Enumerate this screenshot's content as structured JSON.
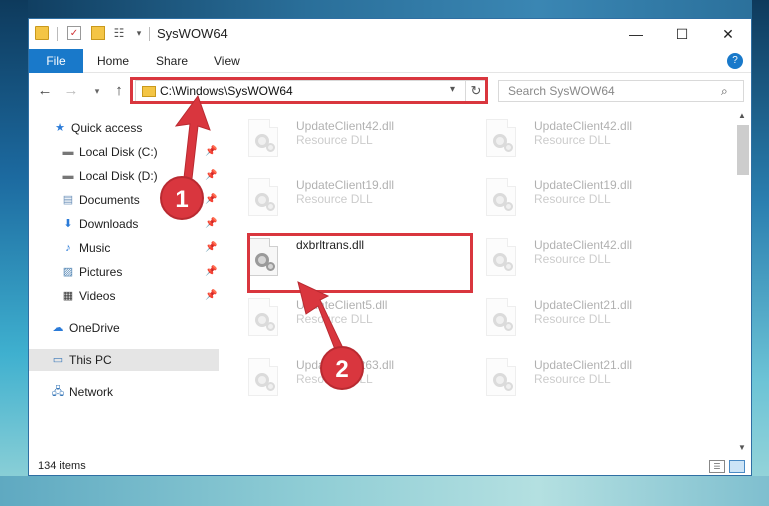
{
  "window": {
    "title": "SysWOW64",
    "minimize_icon": "minimize-icon",
    "maximize_icon": "maximize-icon",
    "close_icon": "close-icon"
  },
  "ribbon": {
    "tabs": [
      {
        "label": "File"
      },
      {
        "label": "Home"
      },
      {
        "label": "Share"
      },
      {
        "label": "View"
      }
    ]
  },
  "navigation": {
    "address": "C:\\Windows\\SysWOW64",
    "search_placeholder": "Search SysWOW64"
  },
  "sidebar": {
    "items": [
      {
        "label": "Quick access",
        "icon": "star-icon"
      },
      {
        "label": "Local Disk (C:)",
        "icon": "drive-icon",
        "pinned": true
      },
      {
        "label": "Local Disk (D:)",
        "icon": "drive-icon",
        "pinned": true
      },
      {
        "label": "Documents",
        "icon": "documents-icon",
        "pinned": true
      },
      {
        "label": "Downloads",
        "icon": "download-icon",
        "pinned": true
      },
      {
        "label": "Music",
        "icon": "music-icon",
        "pinned": true
      },
      {
        "label": "Pictures",
        "icon": "pictures-icon",
        "pinned": true
      },
      {
        "label": "Videos",
        "icon": "videos-icon",
        "pinned": true
      },
      {
        "label": "OneDrive",
        "icon": "cloud-icon"
      },
      {
        "label": "This PC",
        "icon": "computer-icon",
        "selected": true
      },
      {
        "label": "Network",
        "icon": "network-icon"
      }
    ]
  },
  "files": {
    "left": [
      {
        "name": "UpdateClient42.dll",
        "type": "Resource DLL"
      },
      {
        "name": "UpdateClient19.dll",
        "type": "Resource DLL"
      },
      {
        "name": "dxbrltrans.dll",
        "type": ""
      },
      {
        "name": "UpdateClient5.dll",
        "type": "Resource DLL"
      },
      {
        "name": "UpdateClient63.dll",
        "type": "Resource DLL"
      }
    ],
    "right": [
      {
        "name": "UpdateClient42.dll",
        "type": "Resource DLL"
      },
      {
        "name": "UpdateClient19.dll",
        "type": "Resource DLL"
      },
      {
        "name": "UpdateClient42.dll",
        "type": "Resource DLL"
      },
      {
        "name": "UpdateClient21.dll",
        "type": "Resource DLL"
      },
      {
        "name": "UpdateClient21.dll",
        "type": "Resource DLL"
      }
    ]
  },
  "status": {
    "item_count": "134 items"
  },
  "annotations": {
    "step1": "1",
    "step2": "2",
    "color": "#d9363e"
  },
  "colors": {
    "accent": "#1979ca",
    "selection": "#e5e5e5"
  }
}
